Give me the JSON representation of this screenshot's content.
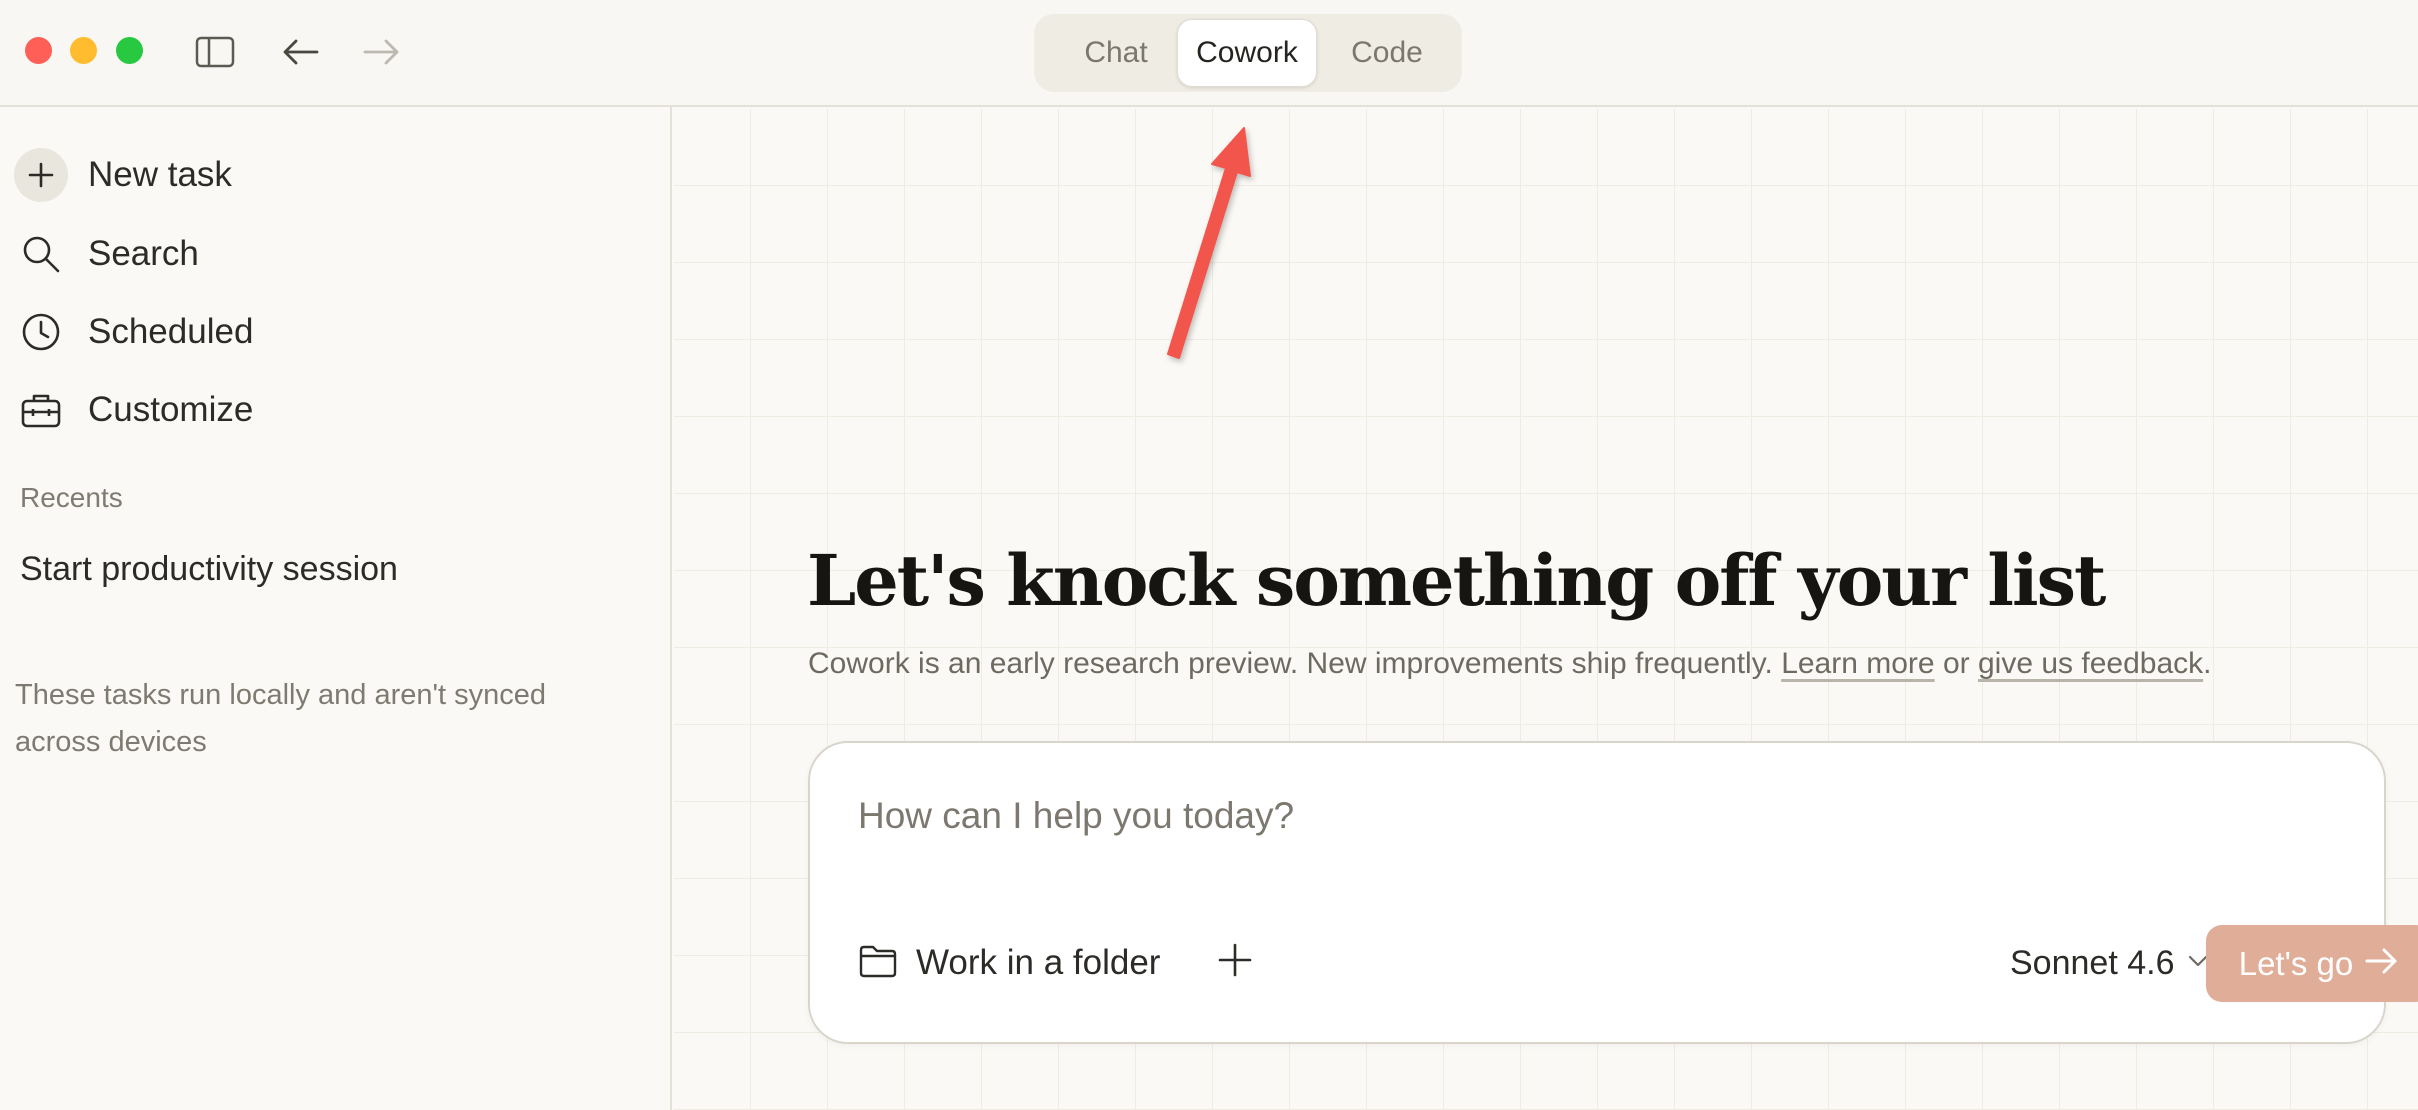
{
  "titlebar": {
    "nav_icons": [
      "sidebar-toggle-icon",
      "back-arrow-icon",
      "forward-arrow-icon"
    ],
    "modes": [
      {
        "label": "Chat",
        "active": false
      },
      {
        "label": "Cowork",
        "active": true
      },
      {
        "label": "Code",
        "active": false
      }
    ]
  },
  "sidebar": {
    "items": [
      {
        "label": "New task",
        "icon": "plus-icon"
      },
      {
        "label": "Search",
        "icon": "search-icon"
      },
      {
        "label": "Scheduled",
        "icon": "clock-icon"
      },
      {
        "label": "Customize",
        "icon": "toolbox-icon"
      }
    ],
    "recents_title": "Recents",
    "recents": [
      "Start productivity session"
    ],
    "note": "These tasks run locally and aren't synced across devices"
  },
  "main": {
    "headline": "Let's knock something off your list",
    "subline_text": "Cowork is an early research preview. New improvements ship frequently.",
    "learn_more": "Learn more",
    "or_text": "or",
    "feedback": "give us feedback",
    "period": ".",
    "composer": {
      "placeholder": "How can I help you today?",
      "folder_label": "Work in a folder",
      "model": "Sonnet 4.6",
      "submit_label": "Let's go"
    }
  },
  "colors": {
    "accent_button": "#e0ae98",
    "annotation_arrow": "#f2554b",
    "background": "#faf9f5"
  }
}
